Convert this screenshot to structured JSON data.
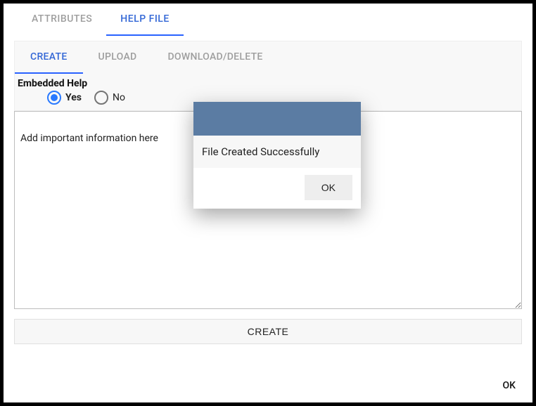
{
  "tabs": {
    "attributes": "ATTRIBUTES",
    "helpFile": "HELP FILE"
  },
  "subtabs": {
    "create": "CREATE",
    "upload": "UPLOAD",
    "downloadDelete": "DOWNLOAD/DELETE"
  },
  "embedded": {
    "label": "Embedded Help",
    "yes": "Yes",
    "no": "No"
  },
  "textarea": {
    "value": "Add important information here"
  },
  "createButton": "CREATE",
  "footerOk": "OK",
  "dialog": {
    "message": "File Created Successfully",
    "ok": "OK"
  }
}
